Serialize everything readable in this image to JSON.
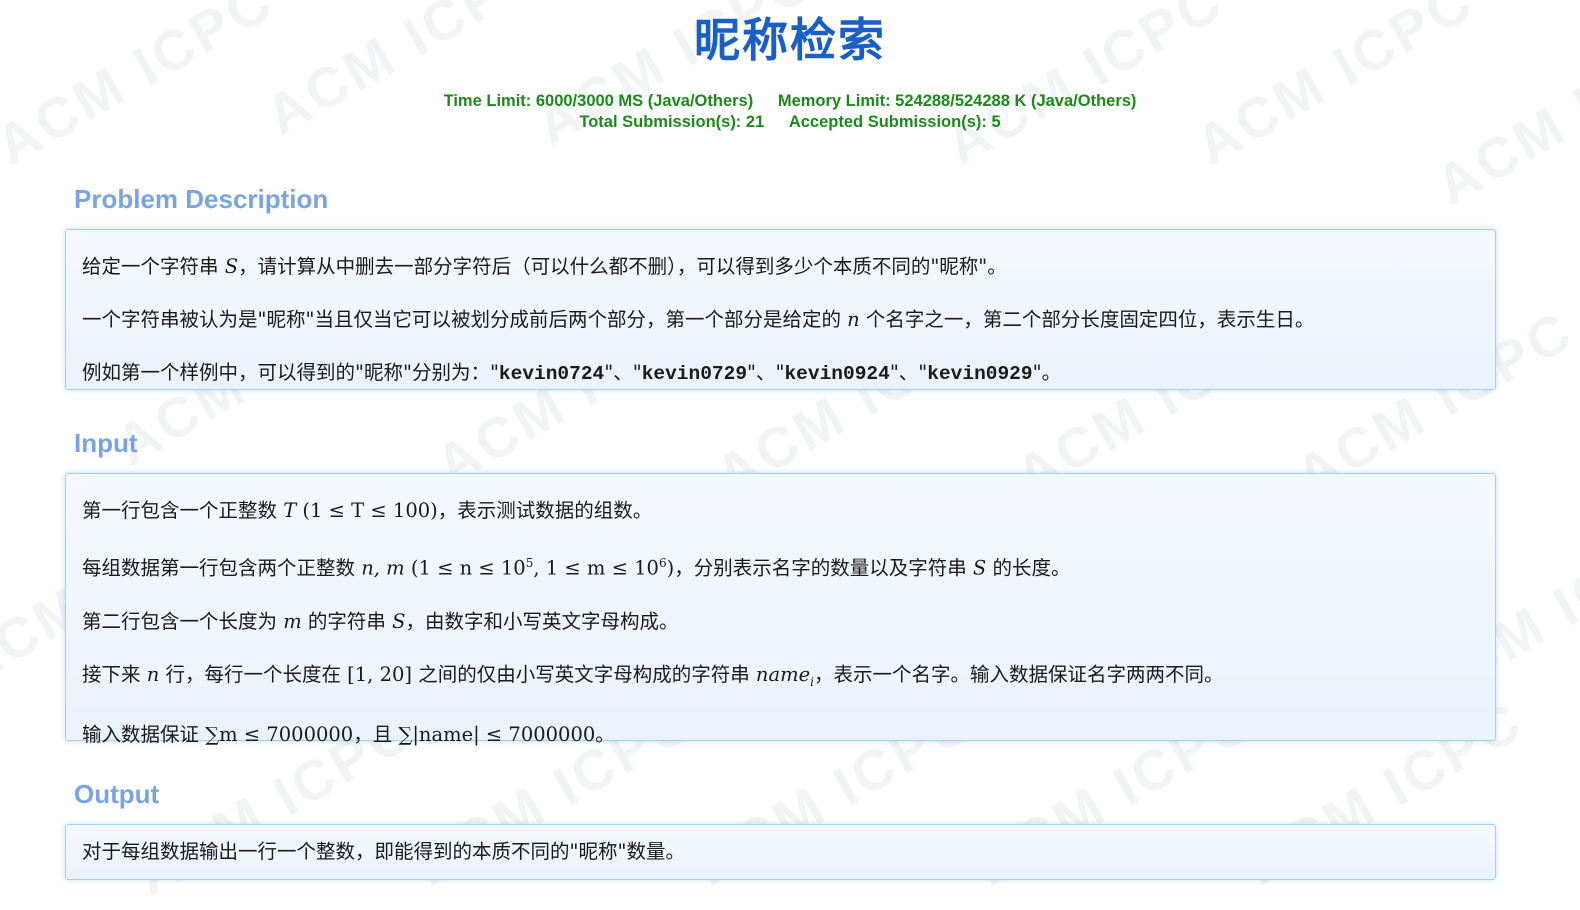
{
  "problem": {
    "title": "昵称检索",
    "time_limit": "Time Limit: 6000/3000 MS (Java/Others)",
    "memory_limit": "Memory Limit: 524288/524288 K (Java/Others)",
    "total_submissions": "Total Submission(s): 21",
    "accepted_submissions": "Accepted Submission(s): 5"
  },
  "watermark": {
    "text": "ACM ICPC"
  },
  "description": {
    "heading": "Problem Description",
    "p1": {
      "a": "给定一个字符串 ",
      "S": "S",
      "b": "，请计算从中删去一部分字符后（可以什么都不删），可以得到多少个本质不同的\"昵称\"。"
    },
    "p2": {
      "a": "一个字符串被认为是\"昵称\"当且仅当它可以被划分成前后两个部分，第一个部分是给定的 ",
      "n": "n",
      "b": " 个名字之一，第二个部分长度固定四位，表示生日。"
    },
    "p3": {
      "a": "例如第一个样例中，可以得到的\"昵称\"分别为：\"",
      "c1": "kevin0724",
      "s1": "\"、\"",
      "c2": "kevin0729",
      "s2": "\"、\"",
      "c3": "kevin0924",
      "s3": "\"、\"",
      "c4": "kevin0929",
      "end": "\"。"
    }
  },
  "input": {
    "heading": "Input",
    "p1": {
      "a": "第一行包含一个正整数 ",
      "T": "T",
      "range": "(1 ≤ T ≤ 100)",
      "b": "，表示测试数据的组数。"
    },
    "p2": {
      "a": "每组数据第一行包含两个正整数 ",
      "nm": "n, m",
      "r1": "(1 ≤ n ≤ 10",
      "e1": "5",
      "r2": ", 1 ≤ m ≤ 10",
      "e2": "6",
      "r3": ")",
      "b": "，分别表示名字的数量以及字符串 ",
      "S": "S",
      "c": " 的长度。"
    },
    "p3": {
      "a": "第二行包含一个长度为 ",
      "m": "m",
      "b": " 的字符串 ",
      "S": "S",
      "c": "，由数字和小写英文字母构成。"
    },
    "p4": {
      "a": "接下来 ",
      "n": "n",
      "b": " 行，每行一个长度在 ",
      "range": "[1, 20]",
      "c": " 之间的仅由小写英文字母构成的字符串 ",
      "name": "name",
      "i": "i",
      "d": "，表示一个名字。输入数据保证名字两两不同。"
    },
    "p5": {
      "a": "输入数据保证 ",
      "sum1": "∑m ≤ 7000000",
      "b": "，且 ",
      "sum2": "∑|name| ≤ 7000000",
      "c": "。"
    }
  },
  "output": {
    "heading": "Output",
    "p1": "对于每组数据输出一行一个整数，即能得到的本质不同的\"昵称\"数量。"
  }
}
